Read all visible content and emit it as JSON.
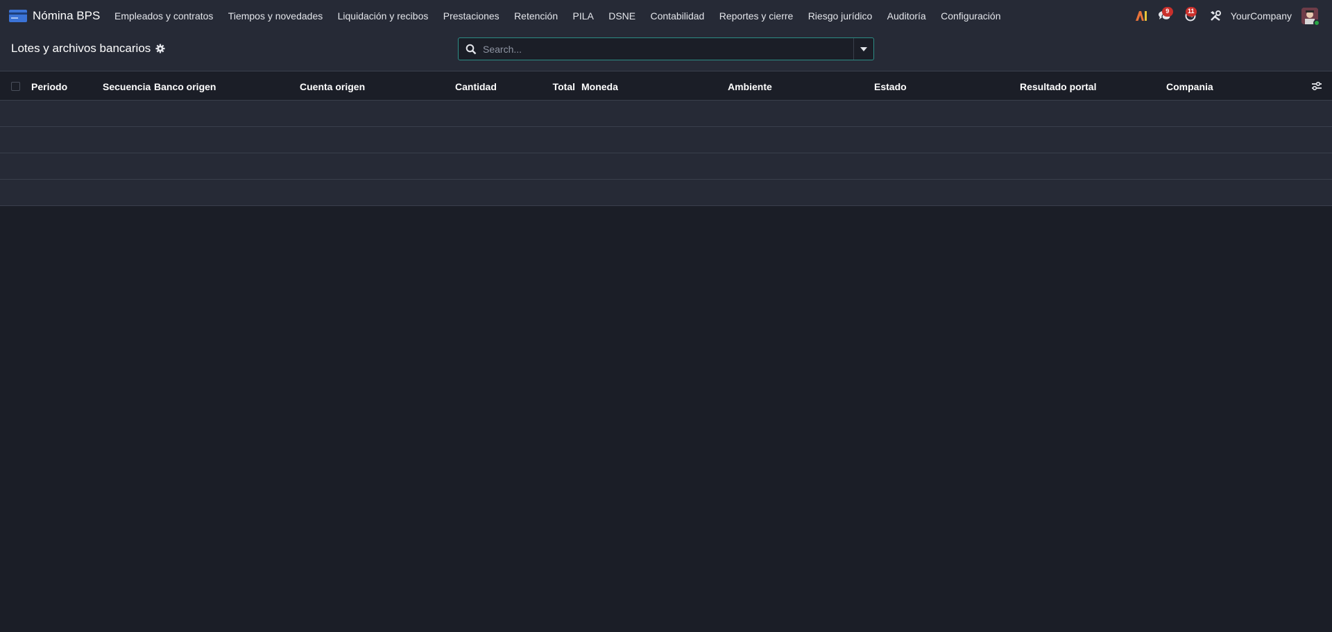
{
  "app": {
    "name": "Nómina BPS",
    "icon": "card-icon"
  },
  "menu": [
    "Empleados y contratos",
    "Tiempos y novedades",
    "Liquidación y recibos",
    "Prestaciones",
    "Retención",
    "PILA",
    "DSNE",
    "Contabilidad",
    "Reportes y cierre",
    "Riesgo jurídico",
    "Auditoría",
    "Configuración"
  ],
  "systray": {
    "ai_label": "AI",
    "messages_count": "9",
    "activities_count": "11",
    "company": "YourCompany"
  },
  "breadcrumb": {
    "title": "Lotes y archivos bancarios"
  },
  "search": {
    "placeholder": "Search..."
  },
  "table": {
    "columns": [
      "Periodo",
      "Secuencia",
      "Banco origen",
      "Cuenta origen",
      "Cantidad",
      "Total",
      "Moneda",
      "Ambiente",
      "Estado",
      "Resultado portal",
      "Compania"
    ]
  },
  "colors": {
    "background": "#1b1e27",
    "navbar": "#262a36",
    "search_border": "#2c8d85",
    "badge": "#c9302c",
    "online": "#28a745"
  }
}
